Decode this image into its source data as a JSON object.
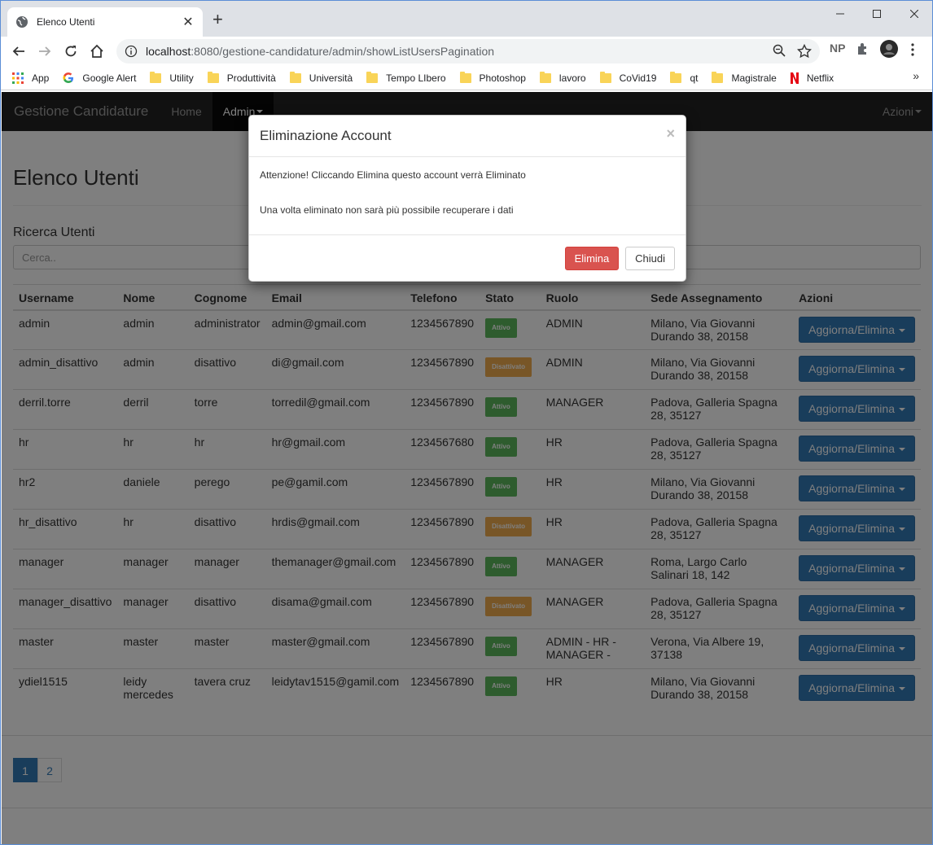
{
  "browser": {
    "tab_title": "Elenco Utenti",
    "url_host": "localhost",
    "url_rest": ":8080/gestione-candidature/admin/showListUsersPagination",
    "ext_np": "NP",
    "bookmarks": [
      "App",
      "Google Alert",
      "Utility",
      "Produttività",
      "Università",
      "Tempo LIbero",
      "Photoshop",
      "lavoro",
      "CoVid19",
      "qt",
      "Magistrale",
      "Netflix"
    ]
  },
  "navbar": {
    "brand": "Gestione Candidature",
    "home": "Home",
    "admin": "Admin",
    "azioni": "Azioni"
  },
  "page": {
    "title": "Elenco Utenti",
    "search_title": "Ricerca Utenti",
    "search_placeholder": "Cerca..",
    "action_label": "Aggiorna/Elimina"
  },
  "table": {
    "headers": [
      "Username",
      "Nome",
      "Cognome",
      "Email",
      "Telefono",
      "Stato",
      "Ruolo",
      "Sede Assegnamento",
      "Azioni"
    ],
    "rows": [
      {
        "username": "admin",
        "nome": "admin",
        "cognome": "administrator",
        "email": "admin@gmail.com",
        "telefono": "1234567890",
        "stato": "Attivo",
        "ruolo": "ADMIN",
        "sede": "Milano, Via Giovanni Durando 38, 20158"
      },
      {
        "username": "admin_disattivo",
        "nome": "admin",
        "cognome": "disattivo",
        "email": "di@gmail.com",
        "telefono": "1234567890",
        "stato": "Disattivato",
        "ruolo": "ADMIN",
        "sede": "Milano, Via Giovanni Durando 38, 20158"
      },
      {
        "username": "derril.torre",
        "nome": "derril",
        "cognome": "torre",
        "email": "torredil@gmail.com",
        "telefono": "1234567890",
        "stato": "Attivo",
        "ruolo": "MANAGER",
        "sede": "Padova, Galleria Spagna 28, 35127"
      },
      {
        "username": "hr",
        "nome": "hr",
        "cognome": "hr",
        "email": "hr@gmail.com",
        "telefono": "1234567680",
        "stato": "Attivo",
        "ruolo": "HR",
        "sede": "Padova, Galleria Spagna 28, 35127"
      },
      {
        "username": "hr2",
        "nome": "daniele",
        "cognome": "perego",
        "email": "pe@gamil.com",
        "telefono": "1234567890",
        "stato": "Attivo",
        "ruolo": "HR",
        "sede": "Milano, Via Giovanni Durando 38, 20158"
      },
      {
        "username": "hr_disattivo",
        "nome": "hr",
        "cognome": "disattivo",
        "email": "hrdis@gmail.com",
        "telefono": "1234567890",
        "stato": "Disattivato",
        "ruolo": "HR",
        "sede": "Padova, Galleria Spagna 28, 35127"
      },
      {
        "username": "manager",
        "nome": "manager",
        "cognome": "manager",
        "email": "themanager@gmail.com",
        "telefono": "1234567890",
        "stato": "Attivo",
        "ruolo": "MANAGER",
        "sede": "Roma, Largo Carlo Salinari 18, 142"
      },
      {
        "username": "manager_disattivo",
        "nome": "manager",
        "cognome": "disattivo",
        "email": "disama@gmail.com",
        "telefono": "1234567890",
        "stato": "Disattivato",
        "ruolo": "MANAGER",
        "sede": "Padova, Galleria Spagna 28, 35127"
      },
      {
        "username": "master",
        "nome": "master",
        "cognome": "master",
        "email": "master@gmail.com",
        "telefono": "1234567890",
        "stato": "Attivo",
        "ruolo": "ADMIN - HR - MANAGER -",
        "sede": "Verona, Via Albere 19, 37138"
      },
      {
        "username": "ydiel1515",
        "nome": "leidy mercedes",
        "cognome": "tavera cruz",
        "email": "leidytav1515@gamil.com",
        "telefono": "1234567890",
        "stato": "Attivo",
        "ruolo": "HR",
        "sede": "Milano, Via Giovanni Durando 38, 20158"
      }
    ]
  },
  "pagination": [
    "1",
    "2"
  ],
  "modal": {
    "title": "Eliminazione Account",
    "close": "×",
    "line1": "Attenzione! Cliccando Elimina questo account verrà Eliminato",
    "line2": "Una volta eliminato non sarà più possibile recuperare i dati",
    "confirm": "Elimina",
    "cancel": "Chiudi"
  },
  "colors": {
    "success": "#5cb85c",
    "warning": "#f0ad4e",
    "primary": "#337ab7",
    "danger": "#d9534f"
  }
}
